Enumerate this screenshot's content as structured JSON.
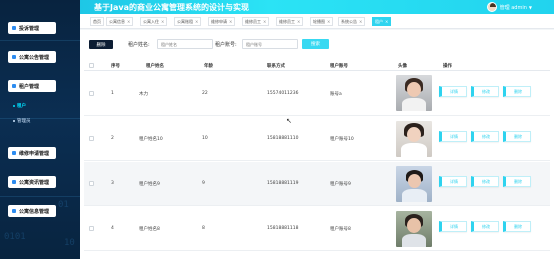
{
  "header": {
    "title": "基于Java的商业公寓管理系统的设计与实现",
    "username": "管理 admin",
    "caret": "▼"
  },
  "sidebar": {
    "deco_text": [
      "0101",
      "01",
      "10"
    ],
    "items": [
      {
        "label": "投诉管理"
      },
      {
        "label": "公寓公告管理"
      },
      {
        "label": "租户管理"
      },
      {
        "label": "维修申请管理"
      },
      {
        "label": "公寓资讯管理"
      },
      {
        "label": "公寓信息管理"
      }
    ],
    "sub_items": [
      {
        "label": "租户",
        "active": true
      },
      {
        "label": "管理员",
        "active": false
      }
    ]
  },
  "tabs": [
    {
      "label": "首页",
      "closable": false
    },
    {
      "label": "公寓信息",
      "closable": true
    },
    {
      "label": "公寓入住",
      "closable": true
    },
    {
      "label": "公寓账租",
      "closable": true
    },
    {
      "label": "维修申请",
      "closable": true
    },
    {
      "label": "维修员工",
      "closable": true
    },
    {
      "label": "维修员工",
      "closable": true
    },
    {
      "label": "轮播图",
      "closable": true
    },
    {
      "label": "系统公告",
      "closable": true
    },
    {
      "label": "租户",
      "closable": true,
      "active": true
    }
  ],
  "toolbar": {
    "delete_label": "删除",
    "name_label": "租户姓名:",
    "name_placeholder": "租户姓名",
    "account_label": "租户账号:",
    "account_placeholder": "租户账号",
    "search_label": "搜索"
  },
  "table": {
    "columns": [
      "序号",
      "租户姓名",
      "年龄",
      "联系方式",
      "租户账号",
      "头像",
      "操作"
    ],
    "rows": [
      {
        "index": "1",
        "name": "木力",
        "age": "22",
        "phone": "15574011236",
        "account": "账号a"
      },
      {
        "index": "2",
        "name": "租户姓名10",
        "age": "10",
        "phone": "15818881110",
        "account": "租户账号10"
      },
      {
        "index": "3",
        "name": "租户姓名9",
        "age": "9",
        "phone": "15818881119",
        "account": "租户账号9"
      },
      {
        "index": "4",
        "name": "租户姓名8",
        "age": "8",
        "phone": "15818881118",
        "account": "租户账号8"
      }
    ],
    "actions": {
      "detail": "详情",
      "edit": "修改",
      "delete": "删除"
    }
  },
  "colors": {
    "accent": "#2fd4ef",
    "sidebar_bg": "#0b2e52",
    "dark_button": "#0c1d33"
  }
}
